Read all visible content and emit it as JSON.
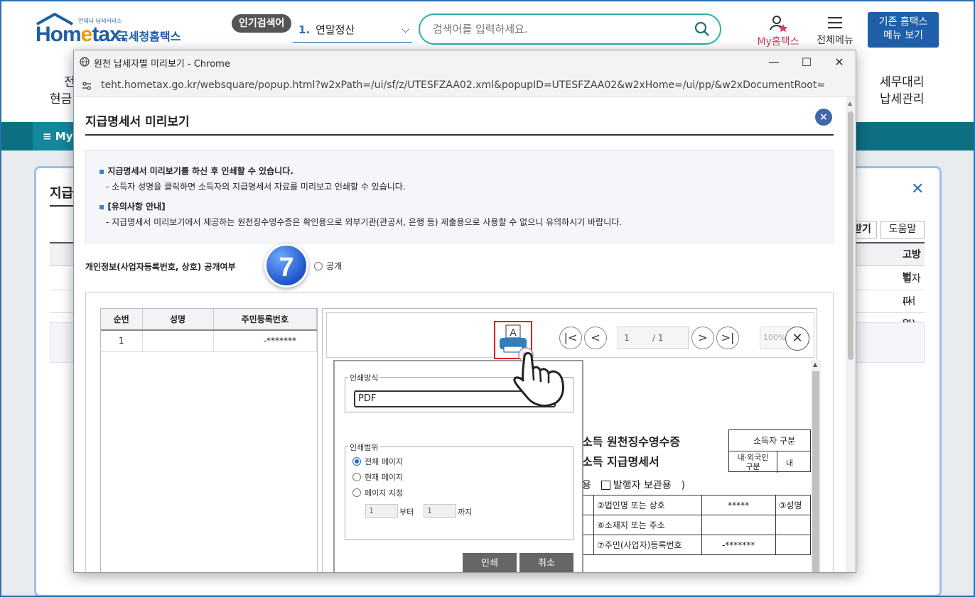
{
  "site": {
    "logo_sub": "언제나 납세서비스",
    "logo_main_a": "Hom",
    "logo_main_e": "e",
    "logo_main_b": "tax.",
    "logo_kr": "국세청홈택스",
    "popular_label": "인기검색어",
    "popular_num": "1.",
    "popular_term": "연말정산",
    "search_placeholder": "검색어를 입력하세요.",
    "my_hometax": "My홈택스",
    "all_menu": "전체메뉴",
    "legacy_line1": "기존 홈택스",
    "legacy_line2": "메뉴 보기",
    "nav_left_1": "전",
    "nav_left_2": "현금",
    "nav_right_1": "세무대리",
    "nav_right_2": "납세관리",
    "teal_tab": "≡  My",
    "bg_title": "지급",
    "bg_btn_1": "받기",
    "bg_btn_2": "도움말",
    "bg_col_header": "고방법",
    "bg_row_1": "전자파일)",
    "bg_row_2": "(서면)"
  },
  "window": {
    "title": "원천 납세자별 미리보기 - Chrome",
    "url": "teht.hometax.go.kr/websquare/popup.html?w2xPath=/ui/sf/z/UTESFZAA02.xml&popupID=UTESFZAA02&w2xHome=/ui/pp/&w2xDocumentRoot=",
    "minimize": "—",
    "maximize": "☐",
    "close": "✕"
  },
  "popup": {
    "title": "지급명세서 미리보기",
    "close": "×",
    "guide_h1": "지급명세서 미리보기를 하신 후 인쇄할 수 있습니다.",
    "guide_d1": "- 소득자 성명을 클릭하면 소득자의 지급명세서 자료를 미리보고 인쇄할 수 있습니다.",
    "guide_h2": "[유의사항 안내]",
    "guide_d2": "- 지급명세서 미리보기에서 제공하는 원천징수영수증은 확인용으로 외부기관(관공서, 은행 등) 제출용으로 사용할 수 없으니 유의하시기 바랍니다.",
    "privacy_label": "개인정보(사업자등록번호, 상호) 공개여부",
    "step_number": "7",
    "radio_public": "공개"
  },
  "list": {
    "headers": [
      "순번",
      "성명",
      "주민등록번호"
    ],
    "rows": [
      {
        "no": "1",
        "name": "",
        "rrn": "-*******"
      }
    ]
  },
  "viewer": {
    "print_icon_letter": "A",
    "first": "|<",
    "prev": "<",
    "current_page": "1",
    "total_pages": "/ 1",
    "next": ">",
    "last": ">|",
    "zoom": "100%",
    "close": "✕"
  },
  "document": {
    "title1": "소득 원천징수영수증",
    "title2": "소득 지급명세서",
    "check_prefix": "용",
    "check_label": "발행자 보관용",
    "check_suffix": ")",
    "type_header": "소득자 구분",
    "type_left": "내·외국인\n구분",
    "type_right": "내",
    "rows": [
      {
        "a": "②법인명 또는 상호",
        "b": "*****",
        "c": "③성명"
      },
      {
        "a": "⑥소재지 또는 주소",
        "b": "",
        "c": ""
      },
      {
        "a": "⑦주민(사업자)등록번호",
        "b": "-*******",
        "c": ""
      }
    ]
  },
  "print_dialog": {
    "method_legend": "인쇄방식",
    "method_value": "PDF",
    "range_legend": "인쇄범위",
    "opt_all": "전체 페이지",
    "opt_current": "현재 페이지",
    "opt_custom": "페이지 지정",
    "from_value": "1",
    "from_label": "부터",
    "to_value": "1",
    "to_label": "까지",
    "print_btn": "인쇄",
    "cancel_btn": "취소"
  }
}
